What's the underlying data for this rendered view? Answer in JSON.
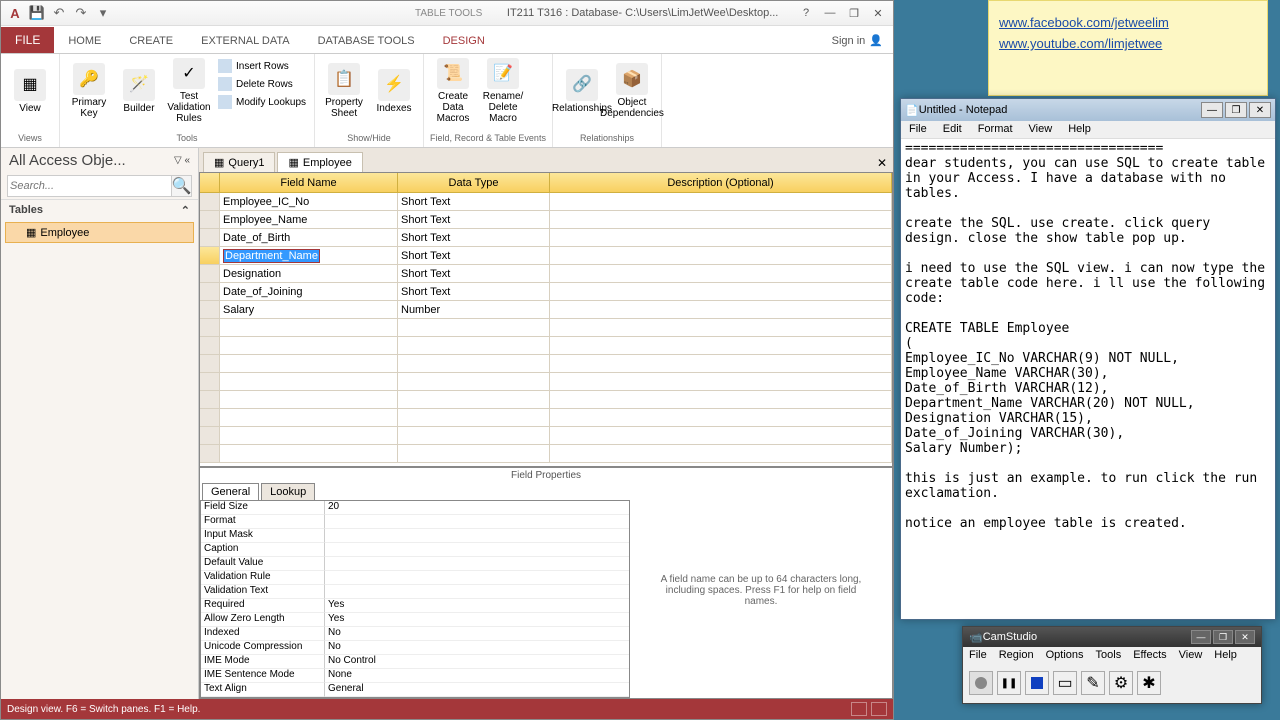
{
  "access": {
    "title": "IT211 T316 : Database- C:\\Users\\LimJetWee\\Desktop...",
    "table_tools": "TABLE TOOLS",
    "tabs": {
      "file": "FILE",
      "home": "HOME",
      "create": "CREATE",
      "external": "EXTERNAL DATA",
      "dbtools": "DATABASE TOOLS",
      "design": "DESIGN"
    },
    "signin": "Sign in",
    "ribbon": {
      "views": {
        "view": "View",
        "label": "Views"
      },
      "tools": {
        "primary": "Primary Key",
        "builder": "Builder",
        "test": "Test Validation Rules",
        "insert": "Insert Rows",
        "delete": "Delete Rows",
        "modify": "Modify Lookups",
        "label": "Tools"
      },
      "showhide": {
        "prop": "Property Sheet",
        "idx": "Indexes",
        "label": "Show/Hide"
      },
      "events": {
        "cdm": "Create Data Macros",
        "rdm": "Rename/ Delete Macro",
        "label": "Field, Record & Table Events"
      },
      "rel": {
        "rel": "Relationships",
        "obj": "Object Dependencies",
        "label": "Relationships"
      }
    },
    "nav": {
      "header": "All Access Obje...",
      "search": "Search...",
      "tables": "Tables",
      "employee": "Employee"
    },
    "doc_tabs": {
      "query": "Query1",
      "employee": "Employee"
    },
    "grid": {
      "headers": {
        "fname": "Field Name",
        "dtype": "Data Type",
        "desc": "Description (Optional)"
      },
      "rows": [
        {
          "name": "Employee_IC_No",
          "type": "Short Text"
        },
        {
          "name": "Employee_Name",
          "type": "Short Text"
        },
        {
          "name": "Date_of_Birth",
          "type": "Short Text"
        },
        {
          "name": "Department_Name",
          "type": "Short Text"
        },
        {
          "name": "Designation",
          "type": "Short Text"
        },
        {
          "name": "Date_of_Joining",
          "type": "Short Text"
        },
        {
          "name": "Salary",
          "type": "Number"
        }
      ]
    },
    "field_props": {
      "title": "Field Properties",
      "tabs": {
        "general": "General",
        "lookup": "Lookup"
      },
      "rows": [
        {
          "label": "Field Size",
          "value": "20"
        },
        {
          "label": "Format",
          "value": ""
        },
        {
          "label": "Input Mask",
          "value": ""
        },
        {
          "label": "Caption",
          "value": ""
        },
        {
          "label": "Default Value",
          "value": ""
        },
        {
          "label": "Validation Rule",
          "value": ""
        },
        {
          "label": "Validation Text",
          "value": ""
        },
        {
          "label": "Required",
          "value": "Yes"
        },
        {
          "label": "Allow Zero Length",
          "value": "Yes"
        },
        {
          "label": "Indexed",
          "value": "No"
        },
        {
          "label": "Unicode Compression",
          "value": "No"
        },
        {
          "label": "IME Mode",
          "value": "No Control"
        },
        {
          "label": "IME Sentence Mode",
          "value": "None"
        },
        {
          "label": "Text Align",
          "value": "General"
        }
      ],
      "help": "A field name can be up to 64 characters long, including spaces. Press F1 for help on field names."
    },
    "status": "Design view.   F6 = Switch panes.   F1 = Help."
  },
  "sticky": {
    "link1": "www.facebook.com/jetweelim",
    "link2": "www.youtube.com/limjetwee"
  },
  "notepad": {
    "title": "Untitled - Notepad",
    "menu": {
      "file": "File",
      "edit": "Edit",
      "format": "Format",
      "view": "View",
      "help": "Help"
    },
    "body": "=================================\ndear students, you can use SQL to create table in your Access. I have a database with no tables.\n\ncreate the SQL. use create. click query design. close the show table pop up.\n\ni need to use the SQL view. i can now type the create table code here. i ll use the following code:\n\nCREATE TABLE Employee\n(\nEmployee_IC_No VARCHAR(9) NOT NULL,\nEmployee_Name VARCHAR(30),\nDate_of_Birth VARCHAR(12),\nDepartment_Name VARCHAR(20) NOT NULL,\nDesignation VARCHAR(15),\nDate_of_Joining VARCHAR(30),\nSalary Number);\n\nthis is just an example. to run click the run exclamation.\n\nnotice an employee table is created."
  },
  "camstudio": {
    "title": "CamStudio",
    "menu": {
      "file": "File",
      "region": "Region",
      "options": "Options",
      "tools": "Tools",
      "effects": "Effects",
      "view": "View",
      "help": "Help"
    }
  }
}
